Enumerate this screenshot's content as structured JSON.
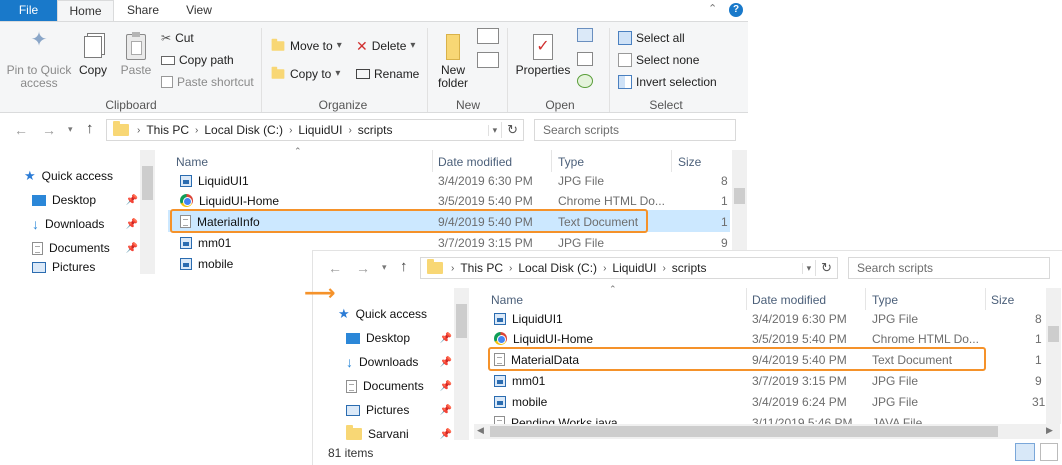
{
  "ribbon": {
    "tabs": {
      "file": "File",
      "home": "Home",
      "share": "Share",
      "view": "View"
    },
    "clipboard": {
      "pin_label": "Pin to Quick access",
      "copy_label": "Copy",
      "paste_label": "Paste",
      "cut_label": "Cut",
      "copy_path_label": "Copy path",
      "paste_shortcut_label": "Paste shortcut",
      "group_label": "Clipboard"
    },
    "organize": {
      "move_to_label": "Move to",
      "copy_to_label": "Copy to",
      "delete_label": "Delete",
      "rename_label": "Rename",
      "group_label": "Organize"
    },
    "new": {
      "new_folder_label": "New folder",
      "group_label": "New"
    },
    "open": {
      "properties_label": "Properties",
      "group_label": "Open"
    },
    "select": {
      "select_all_label": "Select all",
      "select_none_label": "Select none",
      "invert_label": "Invert selection",
      "group_label": "Select"
    }
  },
  "window1": {
    "breadcrumb": [
      "This PC",
      "Local Disk (C:)",
      "LiquidUI",
      "scripts"
    ],
    "search_placeholder": "Search scripts",
    "nav": {
      "quick_access": "Quick access",
      "items": [
        "Desktop",
        "Downloads",
        "Documents",
        "Pictures"
      ]
    },
    "columns": {
      "name": "Name",
      "date": "Date modified",
      "type": "Type",
      "size": "Size"
    },
    "files": [
      {
        "name": "LiquidUI1",
        "date": "3/4/2019 6:30 PM",
        "type": "JPG File",
        "size": "8",
        "icon": "jpg-file-icon"
      },
      {
        "name": "LiquidUI-Home",
        "date": "3/5/2019 5:40 PM",
        "type": "Chrome HTML Do...",
        "size": "1",
        "icon": "chrome-icon"
      },
      {
        "name": "MaterialInfo",
        "date": "9/4/2019 5:40 PM",
        "type": "Text Document",
        "size": "1",
        "icon": "text-file-icon"
      },
      {
        "name": "mm01",
        "date": "3/7/2019 3:15 PM",
        "type": "JPG File",
        "size": "9",
        "icon": "jpg-file-icon"
      },
      {
        "name": "mobile",
        "date": "",
        "type": "",
        "size": "",
        "icon": "jpg-file-icon"
      }
    ]
  },
  "window2": {
    "breadcrumb": [
      "This PC",
      "Local Disk (C:)",
      "LiquidUI",
      "scripts"
    ],
    "search_placeholder": "Search scripts",
    "nav": {
      "quick_access": "Quick access",
      "items": [
        "Desktop",
        "Downloads",
        "Documents",
        "Pictures",
        "Sarvani"
      ]
    },
    "columns": {
      "name": "Name",
      "date": "Date modified",
      "type": "Type",
      "size": "Size"
    },
    "files": [
      {
        "name": "LiquidUI1",
        "date": "3/4/2019 6:30 PM",
        "type": "JPG File",
        "size": "8",
        "icon": "jpg-file-icon"
      },
      {
        "name": "LiquidUI-Home",
        "date": "3/5/2019 5:40 PM",
        "type": "Chrome HTML Do...",
        "size": "1",
        "icon": "chrome-icon"
      },
      {
        "name": "MaterialData",
        "date": "9/4/2019 5:40 PM",
        "type": "Text Document",
        "size": "1",
        "icon": "text-file-icon"
      },
      {
        "name": "mm01",
        "date": "3/7/2019 3:15 PM",
        "type": "JPG File",
        "size": "9",
        "icon": "jpg-file-icon"
      },
      {
        "name": "mobile",
        "date": "3/4/2019 6:24 PM",
        "type": "JPG File",
        "size": "31",
        "icon": "jpg-file-icon"
      },
      {
        "name": "Pending Works.java",
        "date": "3/11/2019 5:46 PM",
        "type": "JAVA File",
        "size": "",
        "icon": "java-file-icon"
      }
    ],
    "status": "81 items"
  },
  "colors": {
    "highlight": "#f5922a",
    "arrow": "#f5922a",
    "file_tab": "#1979ca",
    "selection": "#cce8ff"
  }
}
